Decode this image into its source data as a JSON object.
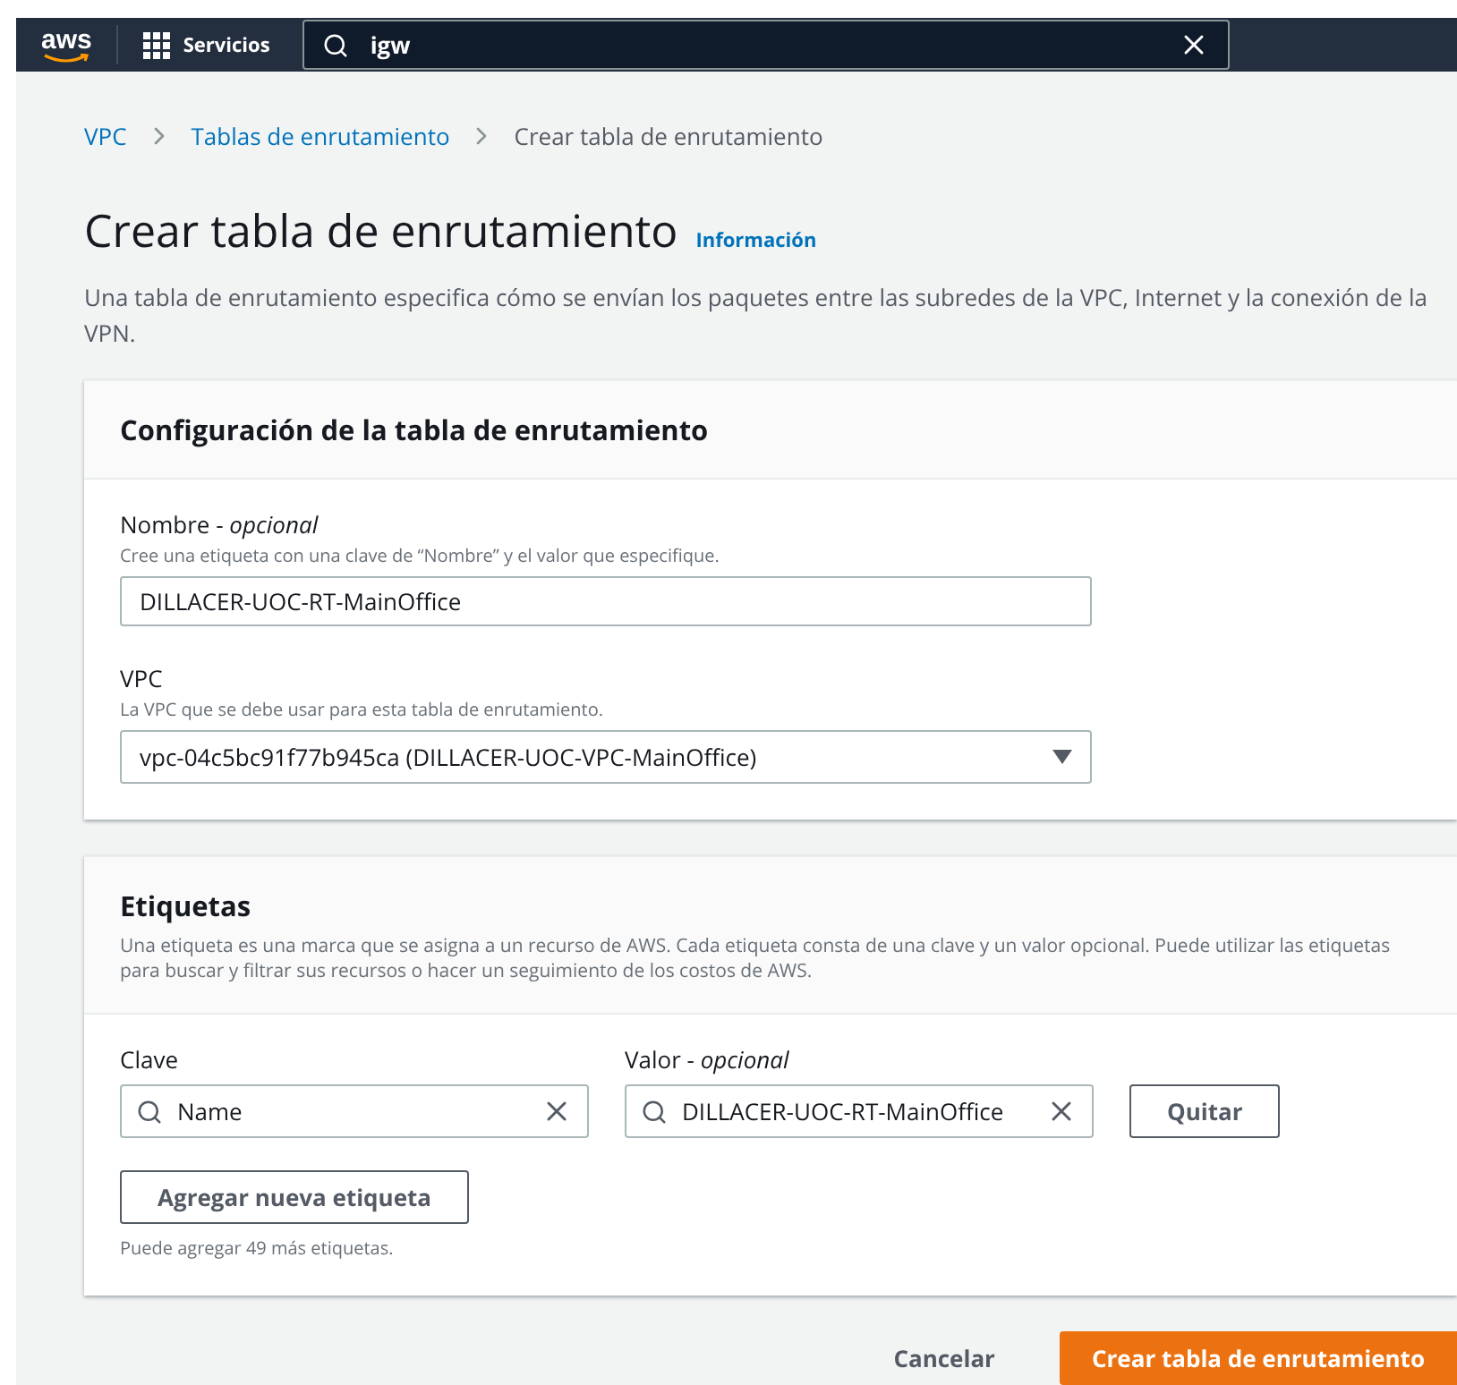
{
  "topbar": {
    "logo": "aws",
    "services": "Servicios",
    "search": {
      "value": "igw"
    }
  },
  "breadcrumb": [
    {
      "label": "VPC",
      "link": true
    },
    {
      "label": "Tablas de enrutamiento",
      "link": true
    },
    {
      "label": "Crear tabla de enrutamiento",
      "link": false
    }
  ],
  "page": {
    "title": "Crear tabla de enrutamiento",
    "info": "Información",
    "description": "Una tabla de enrutamiento especifica cómo se envían los paquetes entre las subredes de la VPC, Internet y la conexión de la VPN."
  },
  "config": {
    "title": "Configuración de la tabla de enrutamiento",
    "name": {
      "label": "Nombre - ",
      "optional": "opcional",
      "hint": "Cree una etiqueta con una clave de “Nombre” y el valor que especifique.",
      "value": "DILLACER-UOC-RT-MainOffice"
    },
    "vpc": {
      "label": "VPC",
      "hint": "La VPC que se debe usar para esta tabla de enrutamiento.",
      "value": "vpc-04c5bc91f77b945ca (DILLACER-UOC-VPC-MainOffice)"
    }
  },
  "tags": {
    "title": "Etiquetas",
    "description": "Una etiqueta es una marca que se asigna a un recurso de AWS. Cada etiqueta consta de una clave y un valor opcional. Puede utilizar las etiquetas para buscar y filtrar sus recursos o hacer un seguimiento de los costos de AWS.",
    "key_label": "Clave",
    "value_label": "Valor - ",
    "value_optional": "opcional",
    "rows": [
      {
        "key": "Name",
        "value": "DILLACER-UOC-RT-MainOffice",
        "remove": "Quitar"
      }
    ],
    "add": "Agregar nueva etiqueta",
    "remaining": "Puede agregar 49 más etiquetas."
  },
  "footer": {
    "cancel": "Cancelar",
    "submit": "Crear tabla de enrutamiento"
  }
}
